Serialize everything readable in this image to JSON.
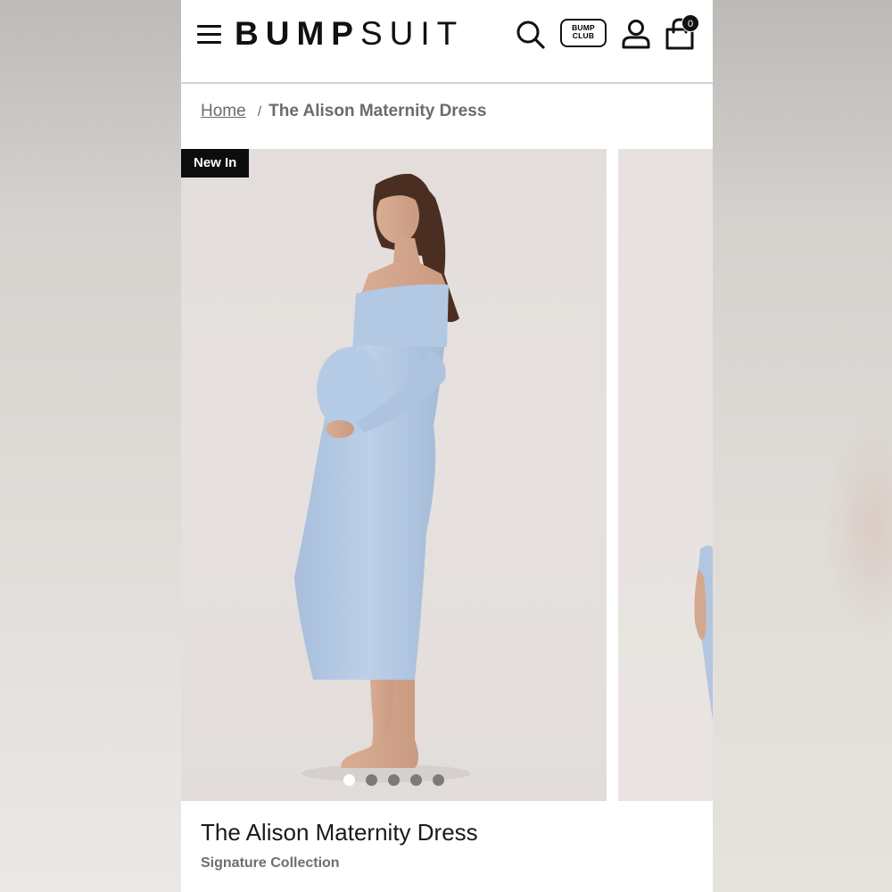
{
  "header": {
    "logo_bold": "BUMP",
    "logo_light": "SUIT",
    "club_line1": "BUMP",
    "club_line2": "CLUB",
    "cart_count": "0"
  },
  "breadcrumb": {
    "home": "Home",
    "separator": "/",
    "current": "The Alison Maternity Dress"
  },
  "gallery": {
    "badge": "New In",
    "image_count": 5,
    "active_index": 0,
    "dress_color": "#b9cde6"
  },
  "product": {
    "title": "The Alison Maternity Dress",
    "collection": "Signature Collection"
  },
  "icons": [
    "menu-icon",
    "search-icon",
    "bump-club-icon",
    "account-icon",
    "cart-icon"
  ]
}
